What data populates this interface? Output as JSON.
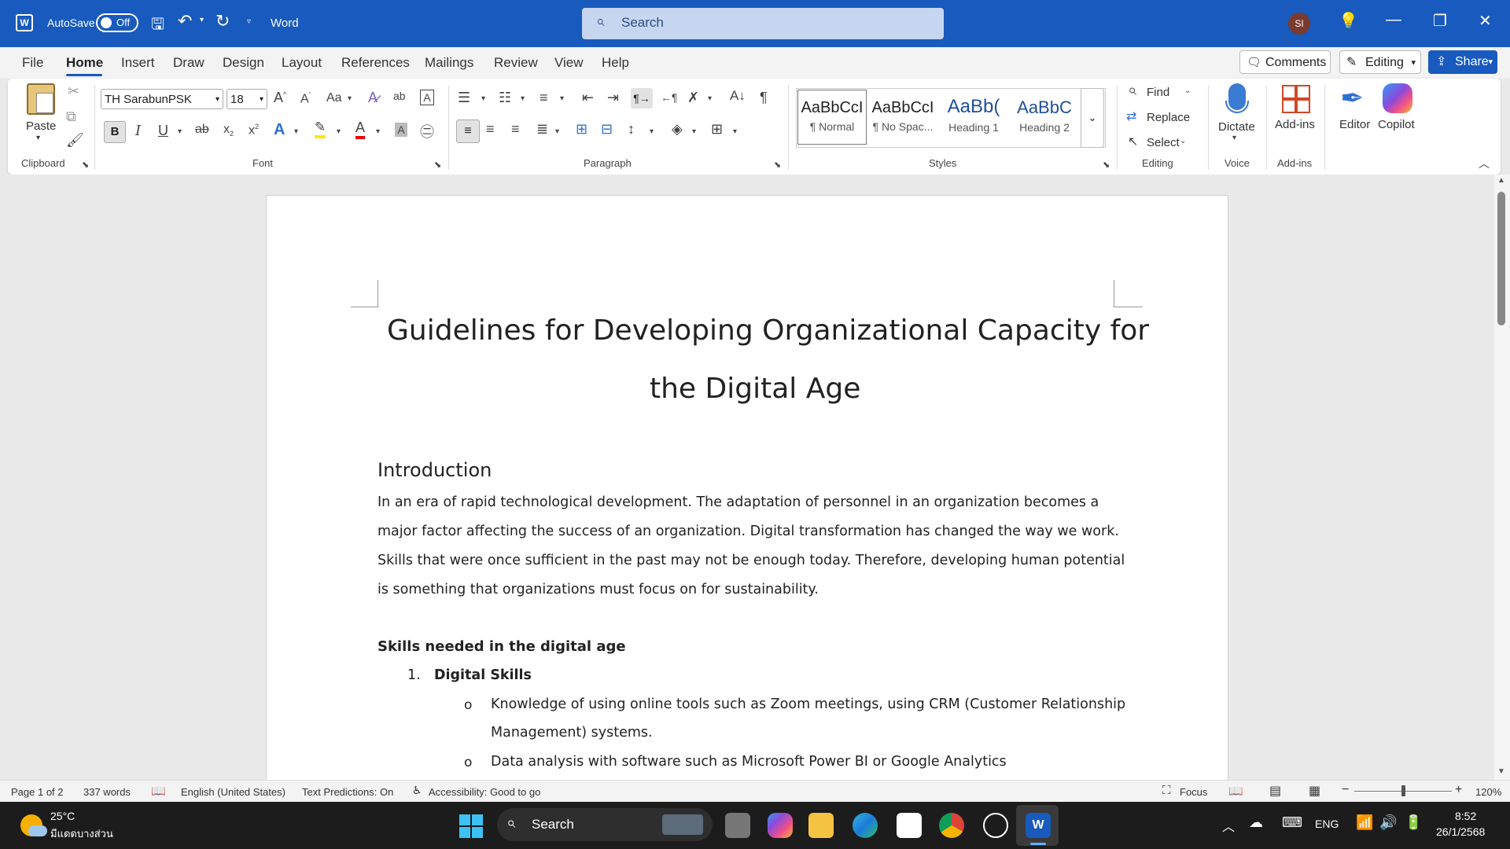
{
  "titlebar": {
    "autosave_label": "AutoSave",
    "autosave_state": "Off",
    "app_name": "Word",
    "search_placeholder": "Search",
    "avatar_initials": "SI"
  },
  "menu": {
    "items": [
      "File",
      "Home",
      "Insert",
      "Draw",
      "Design",
      "Layout",
      "References",
      "Mailings",
      "Review",
      "View",
      "Help"
    ],
    "comments_label": "Comments",
    "editing_label": "Editing",
    "share_label": "Share"
  },
  "ribbon": {
    "clipboard": {
      "paste_label": "Paste",
      "group_label": "Clipboard"
    },
    "font": {
      "font_name": "TH SarabunPSK",
      "font_size": "18",
      "group_label": "Font",
      "case_label": "Aa"
    },
    "paragraph": {
      "group_label": "Paragraph"
    },
    "styles": {
      "group_label": "Styles",
      "items": [
        {
          "preview": "AaBbCcI",
          "name": "¶ Normal"
        },
        {
          "preview": "AaBbCcI",
          "name": "¶ No Spac..."
        },
        {
          "preview": "AaBb(",
          "name": "Heading 1"
        },
        {
          "preview": "AaBbC",
          "name": "Heading 2"
        }
      ]
    },
    "editing": {
      "find_label": "Find",
      "replace_label": "Replace",
      "select_label": "Select",
      "group_label": "Editing"
    },
    "voice": {
      "dictate_label": "Dictate",
      "group_label": "Voice"
    },
    "addins": {
      "addins_label": "Add-ins",
      "group_label": "Add-ins"
    },
    "editor_label": "Editor",
    "copilot_label": "Copilot"
  },
  "document": {
    "title_line1": "Guidelines for Developing Organizational Capacity for",
    "title_line2": "the Digital Age",
    "intro_heading": "Introduction",
    "intro_lines": [
      "In an era of rapid technological development. The adaptation of personnel in an organization becomes a",
      "major factor affecting the success of an organization. Digital transformation has changed the way we work.",
      "Skills that were once sufficient in the past may not be enough today. Therefore, developing human potential",
      "is something that organizations must focus on for sustainability."
    ],
    "skills_heading": "Skills needed in the digital age",
    "list1_number": "1.",
    "list1_title": "Digital Skills",
    "bullet_marker": "o",
    "bullet1_line1": "Knowledge of using online tools such as Zoom meetings, using CRM (Customer Relationship",
    "bullet1_line2": "Management) systems.",
    "bullet2": "Data analysis with software such as Microsoft Power BI or Google Analytics"
  },
  "statusbar": {
    "page": "Page 1 of 2",
    "words": "337 words",
    "language": "English (United States)",
    "predictions": "Text Predictions: On",
    "accessibility": "Accessibility: Good to go",
    "focus": "Focus",
    "zoom": "120%"
  },
  "taskbar": {
    "temperature": "25°C",
    "weather_desc": "มีแดดบางส่วน",
    "search_label": "Search",
    "lang": "ENG",
    "time": "8:52",
    "date": "26/1/2568"
  },
  "colors": {
    "accent": "#185abd",
    "ribbon_bg": "#ffffff",
    "page_bg": "#ffffff"
  }
}
